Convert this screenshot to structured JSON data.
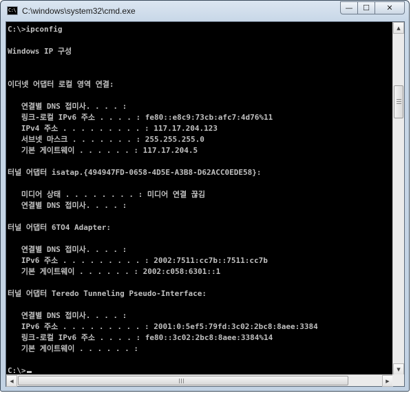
{
  "window": {
    "title": "C:\\windows\\system32\\cmd.exe",
    "icon_label": "C:\\",
    "controls": {
      "minimize": "—",
      "maximize": "☐",
      "close": "✕"
    }
  },
  "console": {
    "lines": [
      "C:\\>ipconfig",
      "",
      "Windows IP 구성",
      "",
      "",
      "이더넷 어댑터 로컬 영역 연결:",
      "",
      "   연결별 DNS 접미사. . . . :",
      "   링크-로컬 IPv6 주소 . . . . : fe80::e8c9:73cb:afc7:4d76%11",
      "   IPv4 주소 . . . . . . . . . : 117.17.204.123",
      "   서브넷 마스크 . . . . . . . : 255.255.255.0",
      "   기본 게이트웨이 . . . . . . : 117.17.204.5",
      "",
      "터널 어댑터 isatap.{494947FD-0658-4D5E-A3B8-D62ACC0EDE58}:",
      "",
      "   미디어 상태 . . . . . . . . : 미디어 연결 끊김",
      "   연결별 DNS 접미사. . . . :",
      "",
      "터널 어댑터 6TO4 Adapter:",
      "",
      "   연결별 DNS 접미사. . . . :",
      "   IPv6 주소 . . . . . . . . . : 2002:7511:cc7b::7511:cc7b",
      "   기본 게이트웨이 . . . . . . : 2002:c058:6301::1",
      "",
      "터널 어댑터 Teredo Tunneling Pseudo-Interface:",
      "",
      "   연결별 DNS 접미사. . . . :",
      "   IPv6 주소 . . . . . . . . . : 2001:0:5ef5:79fd:3c02:2bc8:8aee:3384",
      "   링크-로컬 IPv6 주소 . . . . : fe80::3c02:2bc8:8aee:3384%14",
      "   기본 게이트웨이 . . . . . . :",
      "",
      "C:\\>"
    ]
  },
  "scrollbars": {
    "vertical": {
      "up_arrow": "▲",
      "down_arrow": "▼"
    },
    "horizontal": {
      "left_arrow": "◀",
      "right_arrow": "▶"
    }
  }
}
